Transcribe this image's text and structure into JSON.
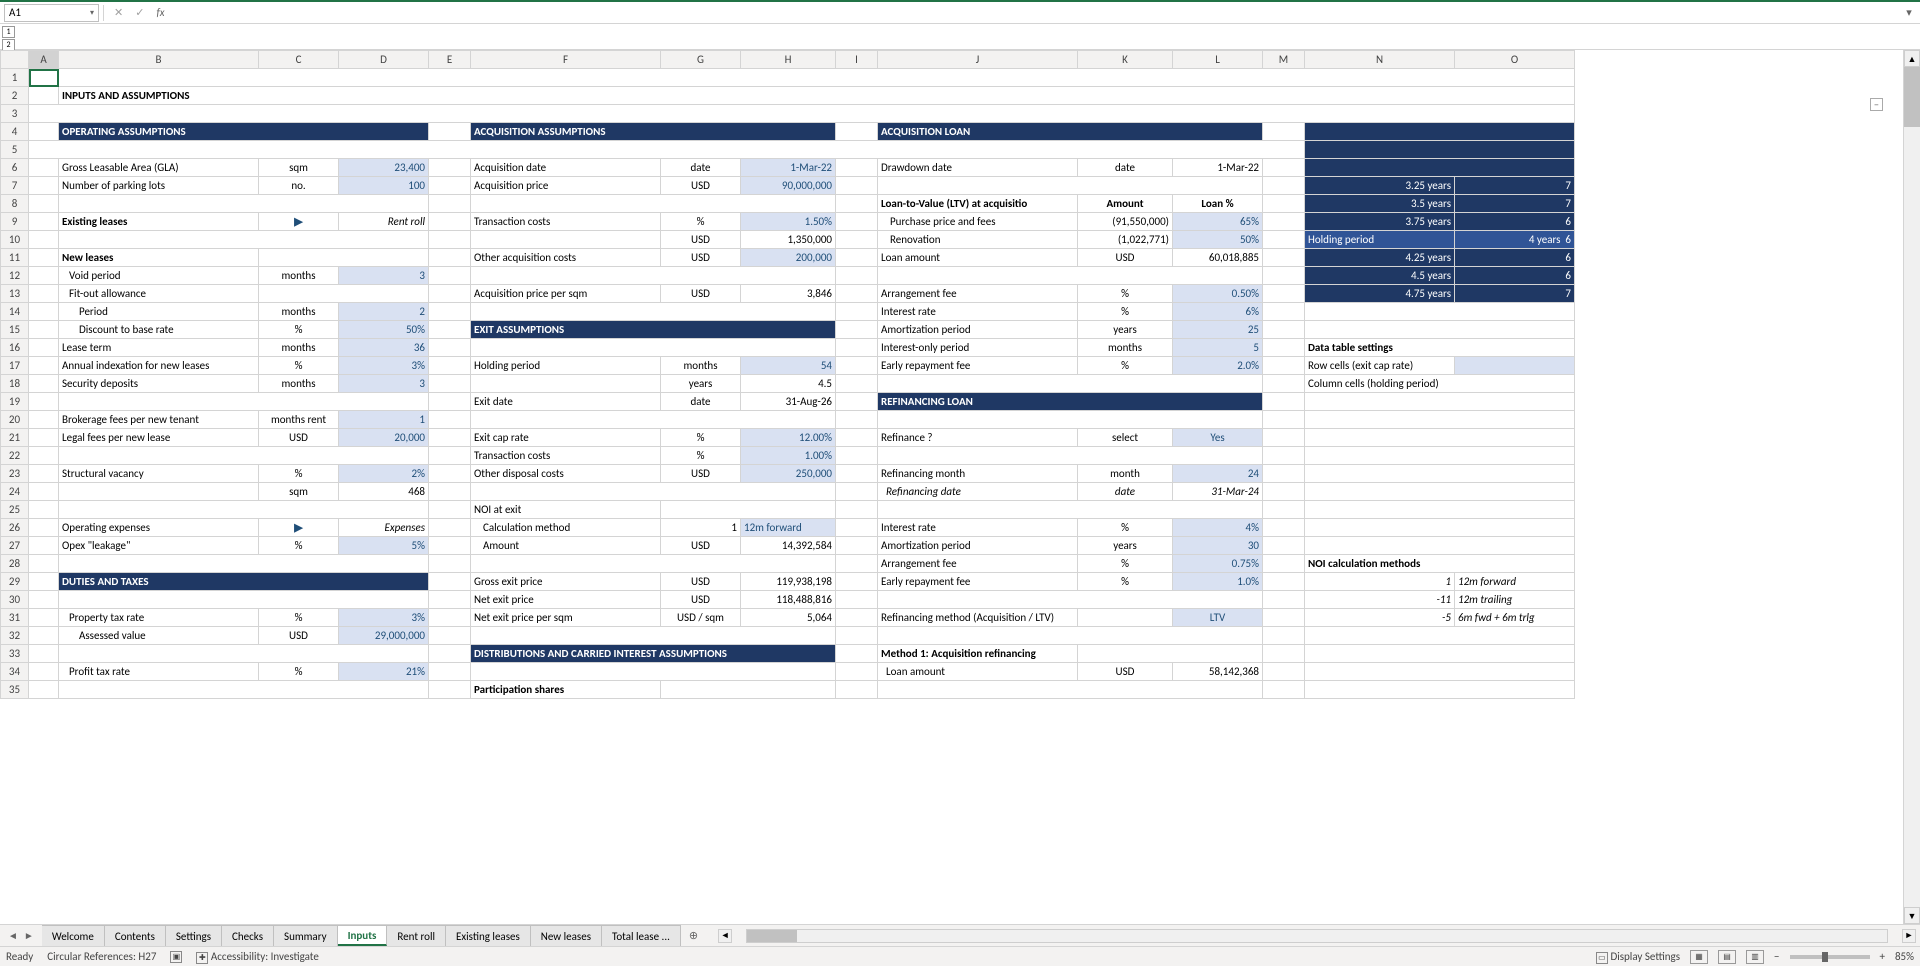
{
  "nameBox": "A1",
  "formula": "",
  "outline": [
    "1",
    "2"
  ],
  "columns": [
    "A",
    "B",
    "C",
    "D",
    "E",
    "F",
    "G",
    "H",
    "I",
    "J",
    "K",
    "L",
    "M",
    "N",
    "O"
  ],
  "title": "INPUTS AND ASSUMPTIONS",
  "hdr": {
    "operating": "OPERATING ASSUMPTIONS",
    "acquisition": "ACQUISITION ASSUMPTIONS",
    "loan": "ACQUISITION LOAN",
    "exit": "EXIT ASSUMPTIONS",
    "refi": "REFINANCING LOAN",
    "duties": "DUTIES AND TAXES",
    "distrib": "DISTRIBUTIONS AND CARRIED INTEREST ASSUMPTIONS"
  },
  "op": {
    "gla": {
      "label": "Gross Leasable Area (GLA)",
      "unit": "sqm",
      "value": "23,400"
    },
    "parking": {
      "label": "Number of parking lots",
      "unit": "no.",
      "value": "100"
    },
    "existing": {
      "label": "Existing leases",
      "link": "▶",
      "value": "Rent roll"
    },
    "newLeases": "New leases",
    "void": {
      "label": "Void period",
      "unit": "months",
      "value": "3"
    },
    "fitout": "Fit-out allowance",
    "fitoutPeriod": {
      "label": "Period",
      "unit": "months",
      "value": "2"
    },
    "discount": {
      "label": "Discount to base rate",
      "unit": "%",
      "value": "50%"
    },
    "leaseTerm": {
      "label": "Lease term",
      "unit": "months",
      "value": "36"
    },
    "indexation": {
      "label": "Annual indexation for new leases",
      "unit": "%",
      "value": "3%"
    },
    "deposits": {
      "label": "Security deposits",
      "unit": "months",
      "value": "3"
    },
    "brokerage": {
      "label": "Brokerage fees per new tenant",
      "unit": "months rent",
      "value": "1"
    },
    "legal": {
      "label": "Legal fees per new lease",
      "unit": "USD",
      "value": "20,000"
    },
    "vacancy": {
      "label": "Structural vacancy",
      "unit": "%",
      "value": "2%"
    },
    "vacSqm": {
      "unit": "sqm",
      "value": "468"
    },
    "opex": {
      "label": "Operating expenses",
      "link": "▶",
      "value": "Expenses"
    },
    "leakage": {
      "label": "Opex \"leakage\"",
      "unit": "%",
      "value": "5%"
    }
  },
  "dt": {
    "propTax": {
      "label": "Property tax rate",
      "unit": "%",
      "value": "3%"
    },
    "assessed": {
      "label": "Assessed value",
      "unit": "USD",
      "value": "29,000,000"
    },
    "profitTax": {
      "label": "Profit tax rate",
      "unit": "%",
      "value": "21%"
    }
  },
  "acq": {
    "date": {
      "label": "Acquisition date",
      "unit": "date",
      "value": "1-Mar-22"
    },
    "price": {
      "label": "Acquisition price",
      "unit": "USD",
      "value": "90,000,000"
    },
    "tcosts": {
      "label": "Transaction costs",
      "unit": "%",
      "value": "1.50%"
    },
    "tcostsUSD": {
      "unit": "USD",
      "value": "1,350,000"
    },
    "other": {
      "label": "Other acquisition costs",
      "unit": "USD",
      "value": "200,000"
    },
    "persqm": {
      "label": "Acquisition price per sqm",
      "unit": "USD",
      "value": "3,846"
    }
  },
  "exit": {
    "holdM": {
      "label": "Holding period",
      "unit": "months",
      "value": "54"
    },
    "holdY": {
      "unit": "years",
      "value": "4.5"
    },
    "date": {
      "label": "Exit date",
      "unit": "date",
      "value": "31-Aug-26"
    },
    "cap": {
      "label": "Exit cap rate",
      "unit": "%",
      "value": "12.00%"
    },
    "tcosts": {
      "label": "Transaction costs",
      "unit": "%",
      "value": "1.00%"
    },
    "other": {
      "label": "Other disposal costs",
      "unit": "USD",
      "value": "250,000"
    },
    "noiLabel": "NOI at exit",
    "calcMethod": {
      "label": "Calculation method",
      "pre": "1",
      "value": "12m forward"
    },
    "amount": {
      "label": "Amount",
      "unit": "USD",
      "value": "14,392,584"
    },
    "gross": {
      "label": "Gross exit price",
      "unit": "USD",
      "value": "119,938,198"
    },
    "net": {
      "label": "Net exit price",
      "unit": "USD",
      "value": "118,488,816"
    },
    "netSqm": {
      "label": "Net exit price per sqm",
      "unit": "USD / sqm",
      "value": "5,064"
    }
  },
  "loan": {
    "draw": {
      "label": "Drawdown date",
      "unit": "date",
      "value": "1-Mar-22"
    },
    "ltvHeader": {
      "label": "Loan-to-Value (LTV) at acquisitio",
      "amt": "Amount",
      "pct": "Loan %"
    },
    "purchase": {
      "label": "Purchase price and fees",
      "amt": "(91,550,000)",
      "pct": "65%"
    },
    "reno": {
      "label": "Renovation",
      "amt": "(1,022,771)",
      "pct": "50%"
    },
    "loanAmt": {
      "label": "Loan amount",
      "unit": "USD",
      "value": "60,018,885"
    },
    "arrFee": {
      "label": "Arrangement fee",
      "unit": "%",
      "value": "0.50%"
    },
    "intRate": {
      "label": "Interest rate",
      "unit": "%",
      "value": "6%"
    },
    "amort": {
      "label": "Amortization period",
      "unit": "years",
      "value": "25"
    },
    "ioPeriod": {
      "label": "Interest-only period",
      "unit": "months",
      "value": "5"
    },
    "early": {
      "label": "Early repayment fee",
      "unit": "%",
      "value": "2.0%"
    }
  },
  "refi": {
    "q": {
      "label": "Refinance ?",
      "unit": "select",
      "value": "Yes"
    },
    "month": {
      "label": "Refinancing month",
      "unit": "month",
      "value": "24"
    },
    "date": {
      "label": "Refinancing date",
      "unit": "date",
      "value": "31-Mar-24"
    },
    "intRate": {
      "label": "Interest rate",
      "unit": "%",
      "value": "4%"
    },
    "amort": {
      "label": "Amortization period",
      "unit": "years",
      "value": "30"
    },
    "arrFee": {
      "label": "Arrangement fee",
      "unit": "%",
      "value": "0.75%"
    },
    "early": {
      "label": "Early repayment fee",
      "unit": "%",
      "value": "1.0%"
    },
    "method": {
      "label": "Refinancing method (Acquisition / LTV)",
      "value": "LTV"
    },
    "m1": "Method 1: Acquisition refinancing",
    "loanAmt": {
      "label": "Loan amount",
      "unit": "USD",
      "value": "58,142,368"
    }
  },
  "right": {
    "periods": [
      {
        "label": "3.25 years",
        "val": "7"
      },
      {
        "label": "3.5 years",
        "val": "7"
      },
      {
        "label": "3.75 years",
        "val": "6"
      },
      {
        "label": "4 years",
        "val": "6"
      },
      {
        "label": "4.25 years",
        "val": "6"
      },
      {
        "label": "4.5 years",
        "val": "6"
      },
      {
        "label": "4.75 years",
        "val": "7"
      }
    ],
    "holding": "Holding period",
    "dtSettings": "Data table settings",
    "rowCells": "Row cells (exit cap rate)",
    "colCells": "Column cells (holding period)",
    "noiMethods": "NOI calculation methods",
    "methods": [
      {
        "n": "1",
        "label": "12m forward"
      },
      {
        "n": "-11",
        "label": "12m trailing"
      },
      {
        "n": "-5",
        "label": "6m fwd + 6m trlg"
      }
    ]
  },
  "participation": "Participation shares",
  "tabs": [
    "Welcome",
    "Contents",
    "Settings",
    "Checks",
    "Summary",
    "Inputs",
    "Rent roll",
    "Existing leases",
    "New leases",
    "Total lease ..."
  ],
  "activeTab": "Inputs",
  "status": {
    "ready": "Ready",
    "circ": "Circular References: H27",
    "access": "Accessibility: Investigate",
    "display": "Display Settings",
    "zoom": "85%"
  }
}
